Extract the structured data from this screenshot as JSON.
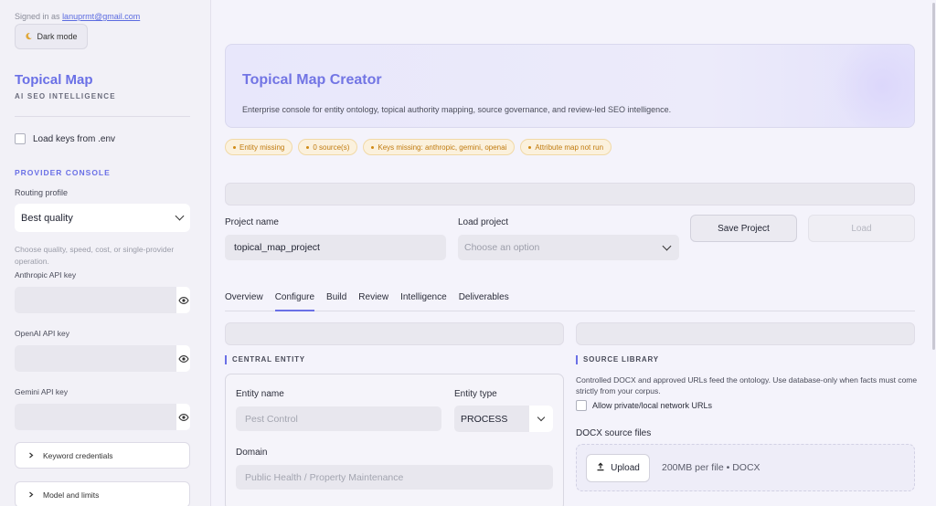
{
  "sidebar": {
    "signed_in_prefix": "Signed in as",
    "signed_in_email": "lanuprmt@gmail.com",
    "dark_mode_label": "Dark mode",
    "brand_title": "Topical Map",
    "brand_subtitle": "AI SEO INTELLIGENCE",
    "load_keys_label": "Load keys from .env",
    "provider_console_title": "PROVIDER CONSOLE",
    "routing_profile_label": "Routing profile",
    "routing_profile_value": "Best quality",
    "routing_help": "Choose quality, speed, cost, or single-provider operation.",
    "api_keys": [
      {
        "label": "Anthropic API key",
        "value": ""
      },
      {
        "label": "OpenAI API key",
        "value": ""
      },
      {
        "label": "Gemini API key",
        "value": ""
      }
    ],
    "expanders": [
      {
        "label": "Keyword credentials"
      },
      {
        "label": "Model and limits"
      }
    ]
  },
  "hero": {
    "title": "Topical Map Creator",
    "description": "Enterprise console for entity ontology, topical authority mapping, source governance, and review-led SEO intelligence."
  },
  "status_chips": [
    {
      "label": "Entity missing"
    },
    {
      "label": "0 source(s)"
    },
    {
      "label": "Keys missing: anthropic, gemini, openai"
    },
    {
      "label": "Attribute map not run"
    }
  ],
  "project": {
    "name_label": "Project name",
    "name_value": "topical_map_project",
    "load_label": "Load project",
    "load_placeholder": "Choose an option",
    "save_button": "Save Project",
    "load_button": "Load"
  },
  "tabs": [
    {
      "label": "Overview",
      "active": false
    },
    {
      "label": "Configure",
      "active": true
    },
    {
      "label": "Build",
      "active": false
    },
    {
      "label": "Review",
      "active": false
    },
    {
      "label": "Intelligence",
      "active": false
    },
    {
      "label": "Deliverables",
      "active": false
    }
  ],
  "central_entity": {
    "section_title": "CENTRAL ENTITY",
    "entity_name_label": "Entity name",
    "entity_name_placeholder": "Pest Control",
    "entity_type_label": "Entity type",
    "entity_type_value": "PROCESS",
    "domain_label": "Domain",
    "domain_placeholder": "Public Health / Property Maintenance"
  },
  "source_library": {
    "section_title": "SOURCE LIBRARY",
    "description": "Controlled DOCX and approved URLs feed the ontology. Use database-only when facts must come strictly from your corpus.",
    "private_urls_label": "Allow private/local network URLs",
    "docx_label": "DOCX source files",
    "upload_button": "Upload",
    "upload_note": "200MB per file • DOCX"
  },
  "colors": {
    "accent": "#6a70e6",
    "chip_text": "#c07a0e",
    "chip_bg": "#fbf1dd"
  }
}
